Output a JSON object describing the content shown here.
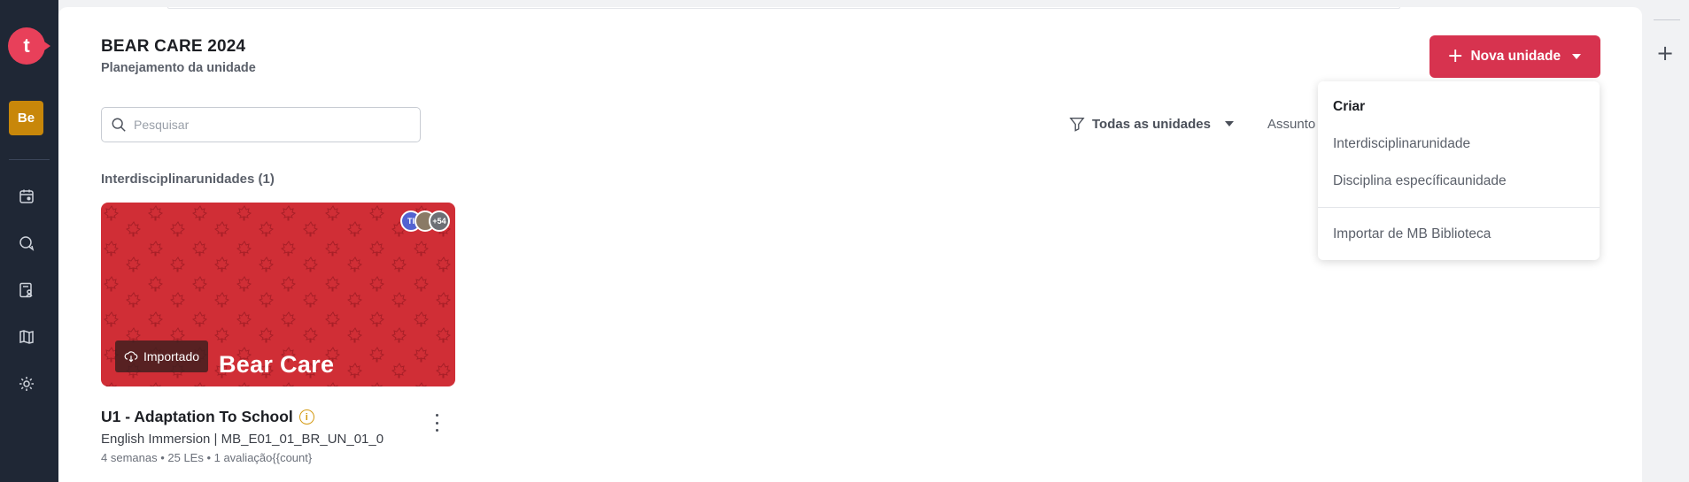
{
  "rail": {
    "logo_letter": "t",
    "school_badge": "Be",
    "icons": [
      "calendar-icon",
      "chat-icon",
      "student-record-icon",
      "library-icon",
      "settings-icon"
    ]
  },
  "header": {
    "title": "BEAR CARE 2024",
    "subtitle": "Planejamento da unidade",
    "new_button_label": "Nova unidade"
  },
  "search": {
    "placeholder": "Pesquisar"
  },
  "filters": {
    "units_filter_label": "Todas as unidades",
    "subject_label": "Assunto"
  },
  "section": {
    "label": "Interdisciplinarunidades (1)"
  },
  "unit_card": {
    "brand_text": "Bear Care",
    "imported_label": "Importado",
    "avatars": [
      "TI",
      "",
      "+54"
    ],
    "title": "U1 - Adaptation To School",
    "info_icon": "i",
    "meta": "English Immersion  | MB_E01_01_BR_UN_01_0",
    "stats": "4 semanas • 25 LEs • 1 avaliação{{count}",
    "image_color": "#d02e36"
  },
  "dropdown": {
    "header": "Criar",
    "items": [
      "Interdisciplinarunidade",
      "Disciplina específicaunidade",
      "Importar de MB Biblioteca"
    ]
  },
  "colors": {
    "rail_bg": "#1f2735",
    "accent": "#d7334f",
    "logo": "#e8405a",
    "badge": "#c8870a"
  }
}
